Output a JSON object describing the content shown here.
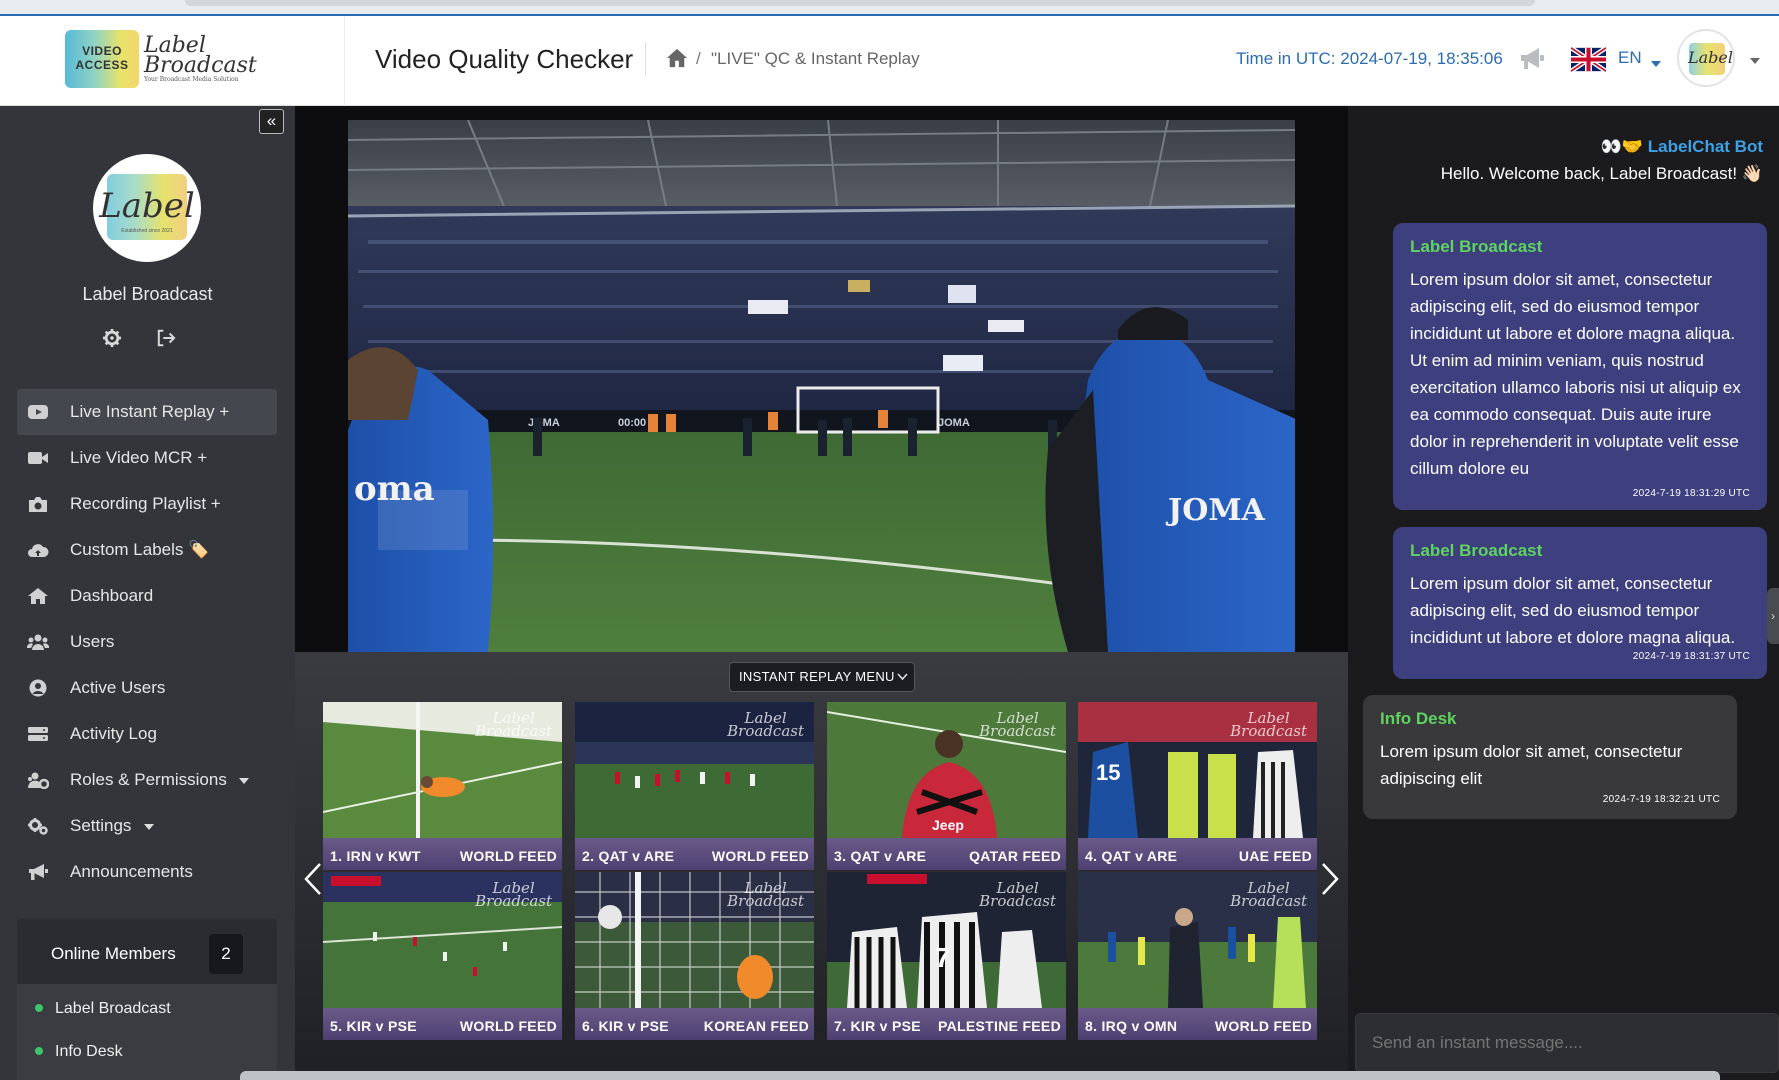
{
  "header": {
    "logo_video_access_line1": "VIDEO",
    "logo_video_access_line2": "ACCESS",
    "logo_label_line1": "Label",
    "logo_label_line2": "Broadcast",
    "logo_label_tagline": "Your Broadcast Media Solution",
    "app_title": "Video Quality Checker",
    "breadcrumb_separator": "/",
    "breadcrumb_page": "\"LIVE\" QC & Instant Replay",
    "utc_label": "Time in UTC:",
    "utc_time": "2024-07-19, 18:35:06",
    "language": "EN",
    "avatar_text": "Label"
  },
  "sidebar": {
    "collapse_glyph": "«",
    "avatar_text": "Label",
    "avatar_subtext": "Established since 2021",
    "profile_name": "Label Broadcast",
    "nav": [
      {
        "label": "Live Instant Replay +",
        "icon": "youtube-icon"
      },
      {
        "label": "Live Video MCR +",
        "icon": "video-camera-icon"
      },
      {
        "label": "Recording Playlist +",
        "icon": "camera-icon"
      },
      {
        "label": "Custom Labels 🏷️",
        "icon": "cloud-upload-icon"
      },
      {
        "label": "Dashboard",
        "icon": "home-icon"
      },
      {
        "label": "Users",
        "icon": "users-icon"
      },
      {
        "label": "Active Users",
        "icon": "user-circle-icon"
      },
      {
        "label": "Activity Log",
        "icon": "server-icon"
      },
      {
        "label": "Roles & Permissions",
        "icon": "users-gear-icon"
      },
      {
        "label": "Settings",
        "icon": "gears-icon"
      },
      {
        "label": "Announcements",
        "icon": "bullhorn-icon"
      }
    ],
    "online_title": "Online Members",
    "online_count": "2",
    "members": [
      "Label Broadcast",
      "Info Desk"
    ]
  },
  "player": {
    "replay_menu_label": "INSTANT REPLAY MENU",
    "thumb_watermark_line1": "Label",
    "thumb_watermark_line2": "Broadcast",
    "thumbnails": [
      {
        "match": "1. IRN v KWT",
        "feed": "WORLD FEED"
      },
      {
        "match": "2. QAT v ARE",
        "feed": "WORLD FEED"
      },
      {
        "match": "3. QAT v ARE",
        "feed": "QATAR FEED"
      },
      {
        "match": "4. QAT v ARE",
        "feed": "UAE FEED"
      },
      {
        "match": "5. KIR v PSE",
        "feed": "WORLD FEED"
      },
      {
        "match": "6. KIR v PSE",
        "feed": "KOREAN FEED"
      },
      {
        "match": "7. KIR v PSE",
        "feed": "PALESTINE FEED"
      },
      {
        "match": "8. IRQ v OMN",
        "feed": "WORLD FEED"
      }
    ]
  },
  "chat": {
    "bot_name": "👀🤝 LabelChat Bot",
    "bot_message": "Hello. Welcome back, Label Broadcast! 👋🏻",
    "messages": [
      {
        "author": "Label Broadcast",
        "text": "Lorem ipsum dolor sit amet, consectetur adipiscing elit, sed do eiusmod tempor incididunt ut labore et dolore magna aliqua. Ut enim ad minim veniam, quis nostrud exercitation ullamco laboris nisi ut aliquip ex ea commodo consequat. Duis aute irure dolor in reprehenderit in voluptate velit esse cillum dolore eu",
        "time": "2024-7-19 18:31:29 UTC"
      },
      {
        "author": "Label Broadcast",
        "text": "Lorem ipsum dolor sit amet, consectetur adipiscing elit, sed do eiusmod tempor incididunt ut labore et dolore magna aliqua.",
        "time": "2024-7-19 18:31:37 UTC"
      },
      {
        "author": "Info Desk",
        "text": "Lorem ipsum dolor sit amet, consectetur adipiscing elit",
        "time": "2024-7-19 18:32:21 UTC"
      }
    ],
    "input_placeholder": "Send an instant message...."
  },
  "colors": {
    "accent_blue": "#2b6cb0",
    "chat_author_green": "#5fd35f",
    "bot_blue": "#3ea0e6",
    "my_bubble": "#3d3f7e",
    "other_bubble": "#39393c",
    "online_dot": "#3cc46b"
  }
}
